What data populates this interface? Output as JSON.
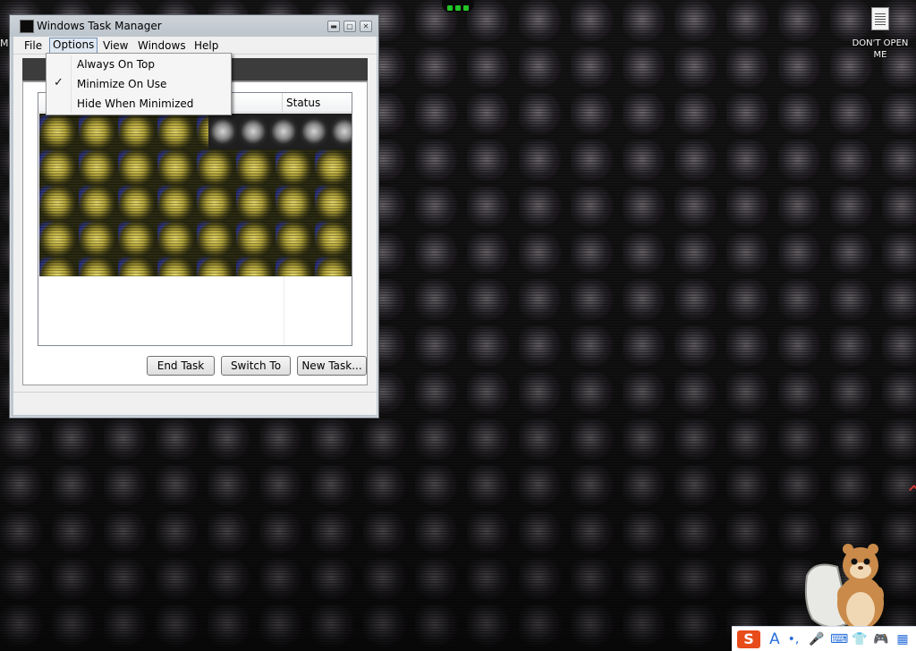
{
  "desktop": {
    "left_edge_text": "M",
    "icon": {
      "name": "document-icon",
      "label": "DON'T OPEN ME"
    }
  },
  "window": {
    "title": "Windows Task Manager",
    "menubar": {
      "file": "File",
      "options": "Options",
      "view": "View",
      "windows": "Windows",
      "help": "Help"
    },
    "list": {
      "columns": [
        "",
        "Status"
      ]
    },
    "buttons": {
      "end_task": "End Task",
      "switch_to": "Switch To",
      "new_task": "New Task..."
    }
  },
  "options_menu": {
    "items": [
      {
        "label": "Always On Top",
        "checked": false
      },
      {
        "label": "Minimize On Use",
        "checked": true
      },
      {
        "label": "Hide When Minimized",
        "checked": false
      }
    ]
  },
  "tray": {
    "sogou": "S",
    "font": "A",
    "punct": "•,",
    "mic": "🎤",
    "keyboard": "⌨",
    "skin": "👕",
    "game": "🎮",
    "grid": "▦"
  },
  "colors": {
    "accent": "#2a6fdb",
    "sogou": "#e84c1a",
    "menu_highlight_border": "#6f8fb3"
  }
}
